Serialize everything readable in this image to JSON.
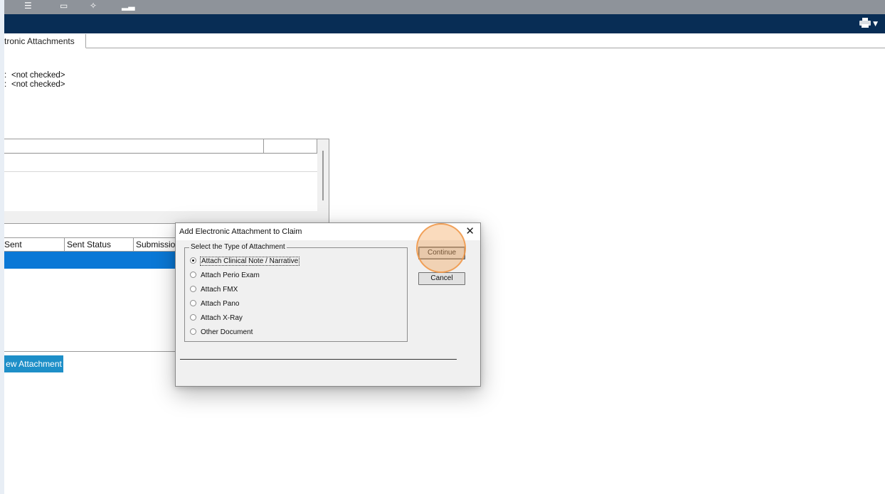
{
  "app": {
    "top_toolbar_icons": [
      "menu-lines-icon",
      "window-icon",
      "tools-icon",
      "signal-icon"
    ],
    "navbar_icon": "printer-icon",
    "tab_label": "tronic Attachments"
  },
  "checks": [
    {
      "value": "<not checked>"
    },
    {
      "value": "<not checked>"
    }
  ],
  "history_table": {
    "columns": [
      "Sent",
      "Sent Status",
      "Submission"
    ]
  },
  "new_attachment_button": "ew Attachment",
  "dialog": {
    "title": "Add Electronic Attachment to Claim",
    "group_label": "Select the Type of Attachment",
    "options": [
      {
        "label": "Attach Clinical Note / Narrative",
        "selected": true
      },
      {
        "label": "Attach Perio Exam",
        "selected": false
      },
      {
        "label": "Attach FMX",
        "selected": false
      },
      {
        "label": "Attach Pano",
        "selected": false
      },
      {
        "label": "Attach X-Ray",
        "selected": false
      },
      {
        "label": "Other Document",
        "selected": false
      }
    ],
    "continue_label": "Continue",
    "cancel_label": "Cancel"
  },
  "colors": {
    "navbar": "#082d55",
    "toolbar": "#8e939a",
    "selected_row": "#0a78d6",
    "new_attachment_button": "#1e8fc8",
    "highlight": "#f3aa62"
  }
}
